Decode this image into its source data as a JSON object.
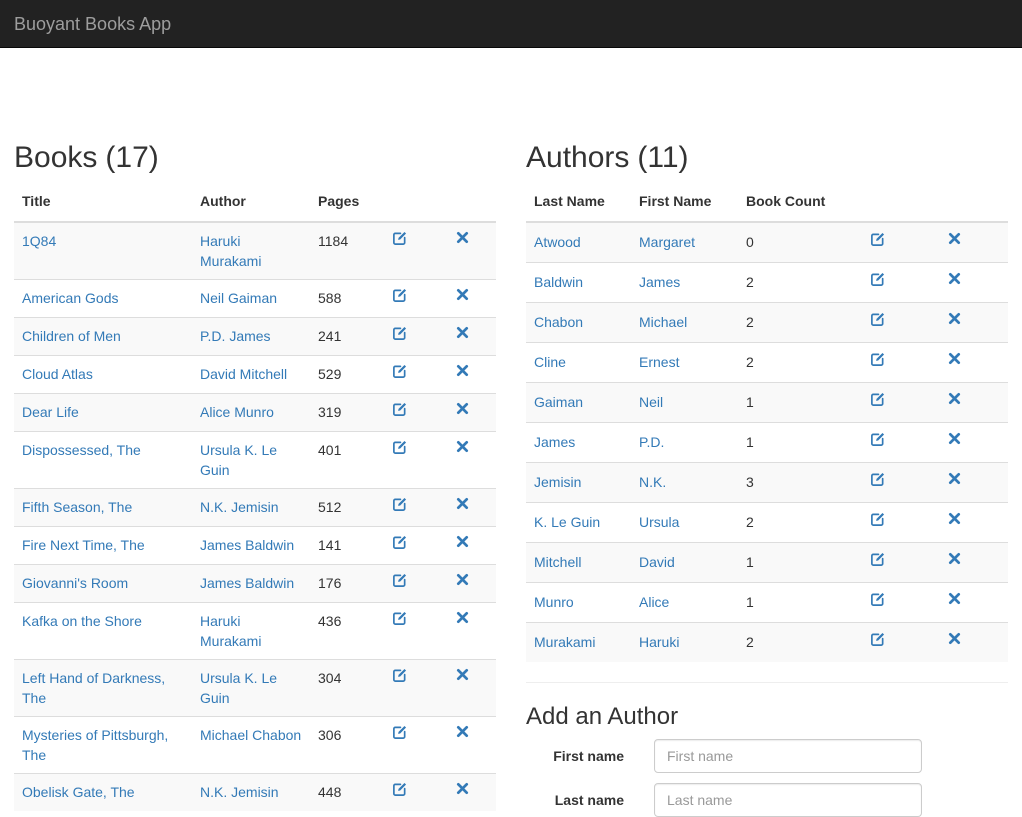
{
  "navbar": {
    "brand": "Buoyant Books App"
  },
  "books": {
    "heading": "Books",
    "count": "(17)",
    "columns": {
      "title": "Title",
      "author": "Author",
      "pages": "Pages"
    },
    "rows": [
      {
        "title": "1Q84",
        "author": "Haruki Murakami",
        "pages": "1184"
      },
      {
        "title": "American Gods",
        "author": "Neil Gaiman",
        "pages": "588"
      },
      {
        "title": "Children of Men",
        "author": "P.D. James",
        "pages": "241"
      },
      {
        "title": "Cloud Atlas",
        "author": "David Mitchell",
        "pages": "529"
      },
      {
        "title": "Dear Life",
        "author": "Alice Munro",
        "pages": "319"
      },
      {
        "title": "Dispossessed, The",
        "author": "Ursula K. Le Guin",
        "pages": "401"
      },
      {
        "title": "Fifth Season, The",
        "author": "N.K. Jemisin",
        "pages": "512"
      },
      {
        "title": "Fire Next Time, The",
        "author": "James Baldwin",
        "pages": "141"
      },
      {
        "title": "Giovanni's Room",
        "author": "James Baldwin",
        "pages": "176"
      },
      {
        "title": "Kafka on the Shore",
        "author": "Haruki Murakami",
        "pages": "436"
      },
      {
        "title": "Left Hand of Darkness, The",
        "author": "Ursula K. Le Guin",
        "pages": "304"
      },
      {
        "title": "Mysteries of Pittsburgh, The",
        "author": "Michael Chabon",
        "pages": "306"
      },
      {
        "title": "Obelisk Gate, The",
        "author": "N.K. Jemisin",
        "pages": "448"
      }
    ]
  },
  "authors": {
    "heading": "Authors",
    "count": "(11)",
    "columns": {
      "last_name": "Last Name",
      "first_name": "First Name",
      "book_count": "Book Count"
    },
    "rows": [
      {
        "last": "Atwood",
        "first": "Margaret",
        "count": "0"
      },
      {
        "last": "Baldwin",
        "first": "James",
        "count": "2"
      },
      {
        "last": "Chabon",
        "first": "Michael",
        "count": "2"
      },
      {
        "last": "Cline",
        "first": "Ernest",
        "count": "2"
      },
      {
        "last": "Gaiman",
        "first": "Neil",
        "count": "1"
      },
      {
        "last": "James",
        "first": "P.D.",
        "count": "1"
      },
      {
        "last": "Jemisin",
        "first": "N.K.",
        "count": "3"
      },
      {
        "last": "K. Le Guin",
        "first": "Ursula",
        "count": "2"
      },
      {
        "last": "Mitchell",
        "first": "David",
        "count": "1"
      },
      {
        "last": "Munro",
        "first": "Alice",
        "count": "1"
      },
      {
        "last": "Murakami",
        "first": "Haruki",
        "count": "2"
      }
    ]
  },
  "add_author": {
    "title": "Add an Author",
    "first_name_label": "First name",
    "first_name_placeholder": "First name",
    "first_name_value": "",
    "last_name_label": "Last name",
    "last_name_placeholder": "Last name",
    "last_name_value": ""
  },
  "icons": {
    "edit": "edit-icon",
    "delete": "delete-icon"
  },
  "colors": {
    "link": "#337ab7",
    "navbar": "#222222",
    "brand": "#9d9d9d"
  }
}
